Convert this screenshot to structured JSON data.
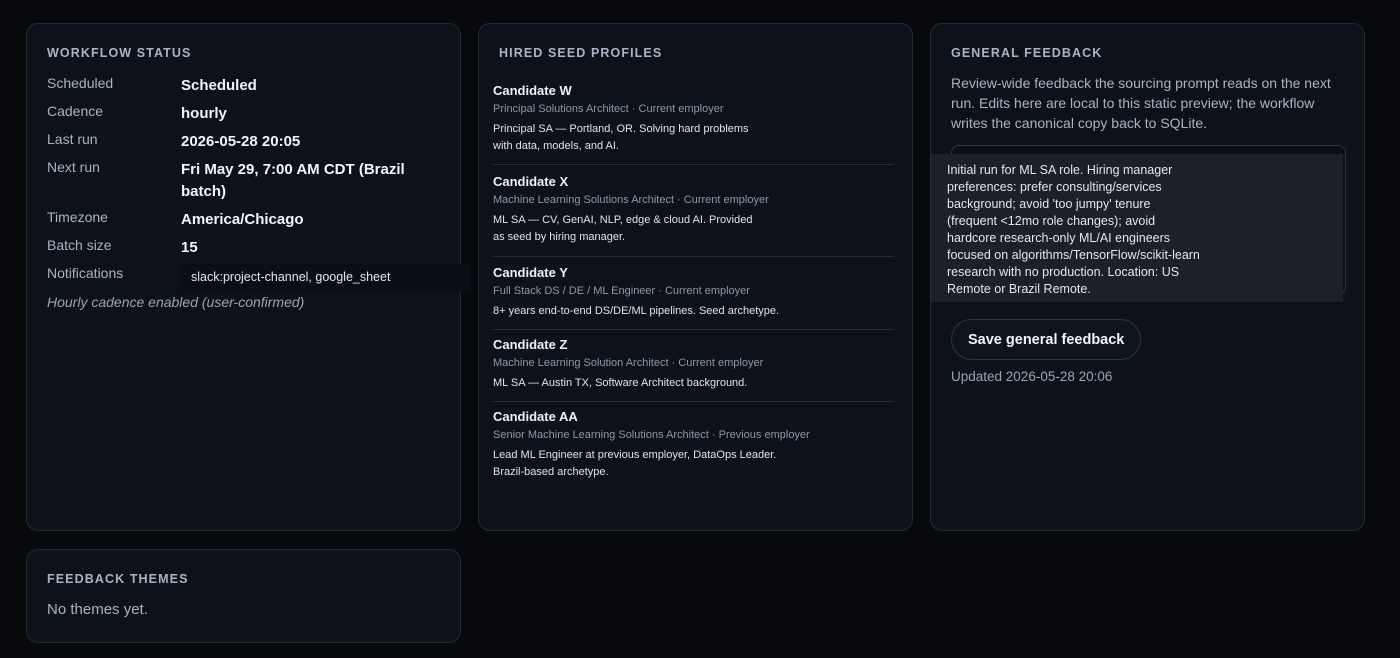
{
  "workflow_status": {
    "title": "Workflow status",
    "rows": [
      {
        "key": "Scheduled",
        "value": "Scheduled"
      },
      {
        "key": "Cadence",
        "value": "hourly"
      },
      {
        "key": "Last run",
        "value": "2026-05-28 20:05"
      },
      {
        "key": "Next run",
        "value": "Fri May 29, 7:00 AM CDT (Brazil batch)"
      },
      {
        "key": "Timezone",
        "value": "America/Chicago"
      },
      {
        "key": "Batch size",
        "value": "15"
      },
      {
        "key": "Notifications",
        "value": "slack:project-channel, google_sheet"
      }
    ],
    "note": "Hourly cadence enabled (user-confirmed)"
  },
  "seed_profiles": {
    "title": "Hired seed profiles",
    "items": [
      {
        "name": "Candidate W",
        "role": "Principal Solutions Architect · Current employer",
        "desc": "Principal SA — Portland, OR. Solving hard problems with data, models, and AI."
      },
      {
        "name": "Candidate X",
        "role": "Machine Learning Solutions Architect · Current employer",
        "desc": "ML SA — CV, GenAI, NLP, edge & cloud AI. Provided as seed by hiring manager."
      },
      {
        "name": "Candidate Y",
        "role": "Full Stack DS / DE / ML Engineer · Current employer",
        "desc": "8+ years end-to-end DS/DE/ML pipelines. Seed archetype."
      },
      {
        "name": "Candidate Z",
        "role": "Machine Learning Solution Architect · Current employer",
        "desc": "ML SA — Austin TX, Software Architect background."
      },
      {
        "name": "Candidate AA",
        "role": "Senior Machine Learning Solutions Architect · Previous employer",
        "desc": "Lead ML Engineer at previous employer, DataOps Leader. Brazil-based archetype."
      }
    ]
  },
  "general_feedback": {
    "title": "General feedback",
    "description": "Review-wide feedback the sourcing prompt reads on the next run. Edits here are local to this static preview; the workflow writes the canonical copy back to SQLite.",
    "text": "Initial run for ML SA role. Hiring manager preferences: prefer consulting/services background; avoid 'too jumpy' tenure (frequent <12mo role changes); avoid hardcore research-only ML/AI engineers focused on algorithms/TensorFlow/scikit-learn research with no production. Location: US Remote or Brazil Remote.",
    "save_label": "Save general feedback",
    "updated": "Updated 2026-05-28 20:06"
  },
  "feedback_themes": {
    "title": "Feedback themes",
    "empty": "No themes yet."
  }
}
